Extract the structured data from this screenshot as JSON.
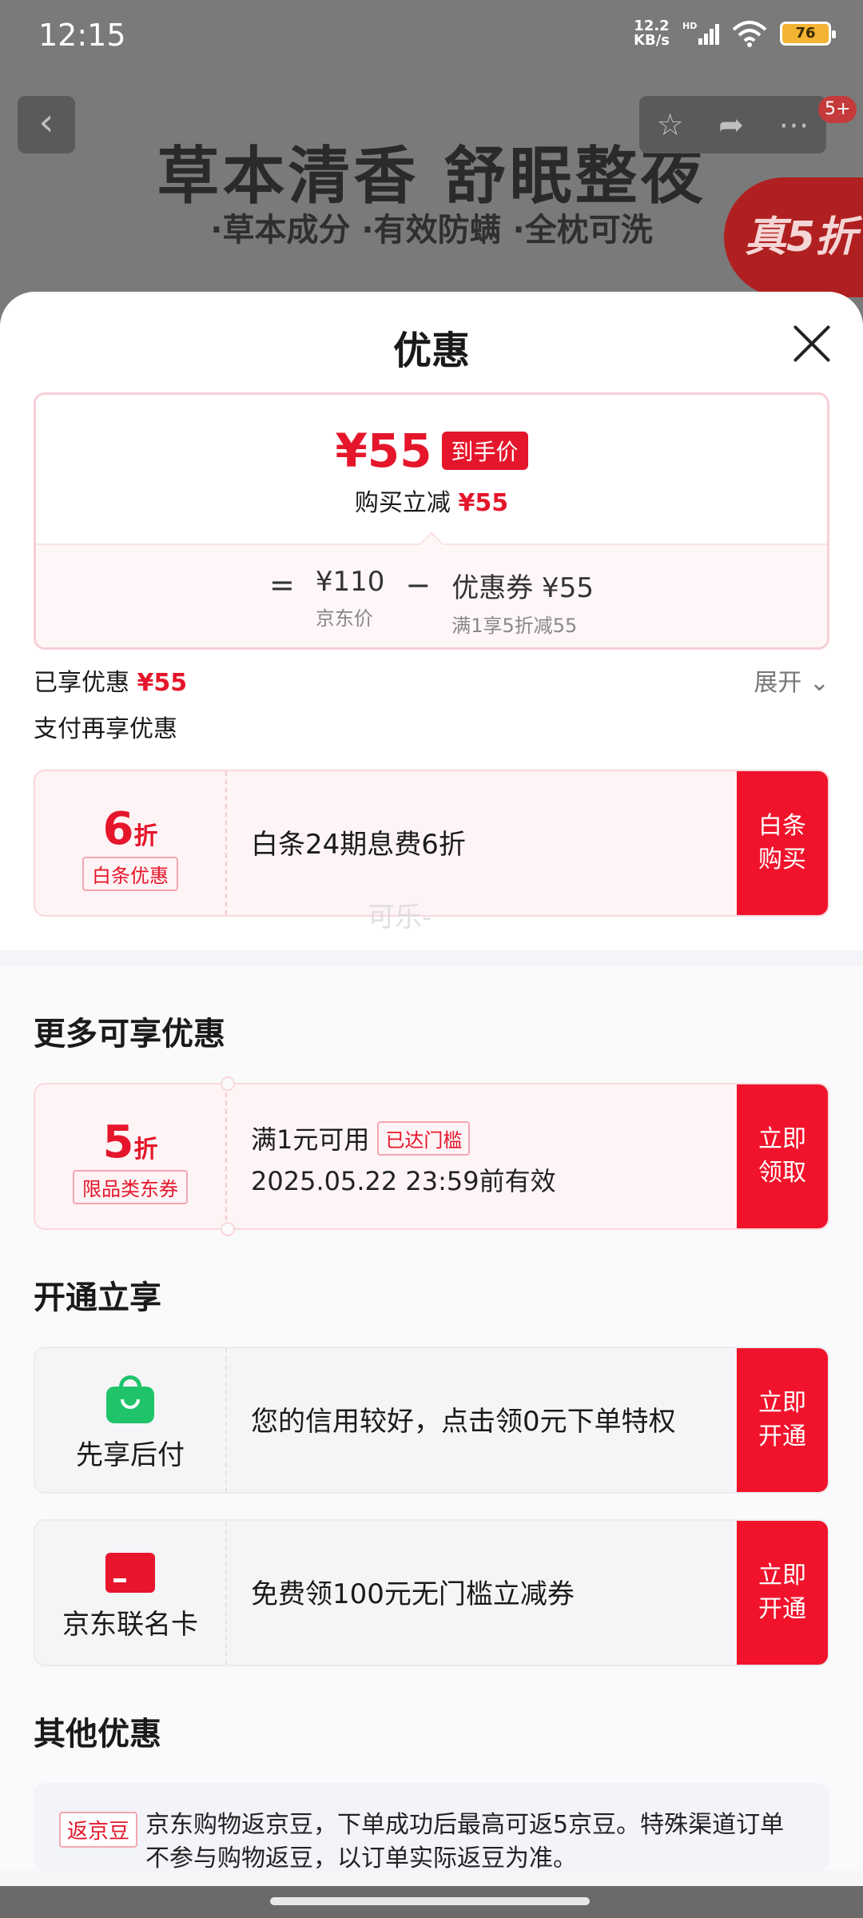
{
  "status_bar": {
    "time": "12:15",
    "net_speed_value": "12.2",
    "net_speed_unit": "KB/s",
    "signal_label": "HD",
    "battery": "76"
  },
  "background": {
    "title": "草本清香 舒眠整夜",
    "tags": "·草本成分  ·有效防螨  ·全枕可洗",
    "promo": "真5折",
    "badge": "5+"
  },
  "sheet": {
    "title": "优惠",
    "price_card": {
      "final_price": "¥55",
      "final_tag": "到手价",
      "reduce_label": "购买立减",
      "reduce_value": "¥55",
      "equals": "=",
      "minus": "−",
      "jd_price": "¥110",
      "jd_price_label": "京东价",
      "coupon_value": "优惠券 ¥55",
      "coupon_label": "满1享5折减55"
    },
    "enjoyed_label": "已享优惠",
    "enjoyed_value": "¥55",
    "expand_label": "展开",
    "pay_again_label": "支付再享优惠",
    "baitiao": {
      "discount_num": "6",
      "discount_unit": "折",
      "tag": "白条优惠",
      "text": "白条24期息费6折",
      "button": "白条购买"
    },
    "more_title": "更多可享优惠",
    "coupon": {
      "discount_num": "5",
      "discount_unit": "折",
      "tag": "限品类东券",
      "title": "满1元可用",
      "status": "已达门槛",
      "valid": "2025.05.22 23:59前有效",
      "button": "立即领取"
    },
    "open_title": "开通立享",
    "pay_later": {
      "label": "先享后付",
      "text": "您的信用较好，点击领0元下单特权",
      "button": "立即开通"
    },
    "co_card": {
      "label": "京东联名卡",
      "text": "免费领100元无门槛立减券",
      "button": "立即开通"
    },
    "other_title": "其他优惠",
    "other": {
      "tag": "返京豆",
      "text": "京东购物返京豆，下单成功后最高可返5京豆。特殊渠道订单不参与购物返豆，以订单实际返豆为准。"
    },
    "watermark": "可乐-"
  }
}
